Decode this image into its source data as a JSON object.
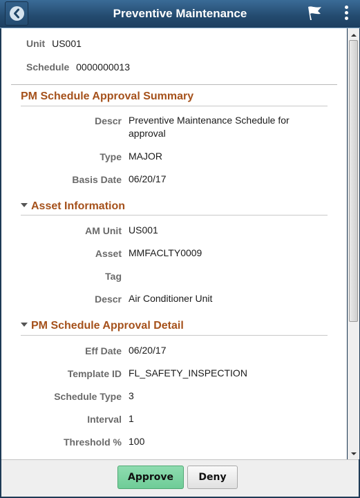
{
  "header": {
    "title": "Preventive Maintenance",
    "back_icon": "back-chevron-icon",
    "flag_icon": "flag-icon",
    "more_icon": "more-vertical-icon"
  },
  "key_fields": [
    {
      "label": "Unit",
      "value": "US001"
    },
    {
      "label": "Schedule",
      "value": "0000000013"
    }
  ],
  "sections": {
    "summary": {
      "title": "PM Schedule Approval Summary",
      "fields": [
        {
          "label": "Descr",
          "value": "Preventive Maintenance Schedule for approval"
        },
        {
          "label": "Type",
          "value": "MAJOR"
        },
        {
          "label": "Basis Date",
          "value": "06/20/17"
        }
      ]
    },
    "asset": {
      "title": "Asset Information",
      "expanded": true,
      "fields": [
        {
          "label": "AM Unit",
          "value": "US001"
        },
        {
          "label": "Asset",
          "value": "MMFACLTY0009"
        },
        {
          "label": "Tag",
          "value": ""
        },
        {
          "label": "Descr",
          "value": "Air Conditioner Unit"
        }
      ]
    },
    "detail": {
      "title": "PM Schedule Approval Detail",
      "expanded": true,
      "fields": [
        {
          "label": "Eff Date",
          "value": "06/20/17"
        },
        {
          "label": "Template ID",
          "value": "FL_SAFETY_INSPECTION"
        },
        {
          "label": "Schedule Type",
          "value": "3"
        },
        {
          "label": "Interval",
          "value": "1"
        },
        {
          "label": "Threshold %",
          "value": "100"
        }
      ]
    }
  },
  "footer": {
    "approve_label": "Approve",
    "deny_label": "Deny"
  },
  "colors": {
    "header_bg": "#234a6e",
    "section_title": "#a5511b",
    "approve_bg": "#7ad3a2"
  }
}
